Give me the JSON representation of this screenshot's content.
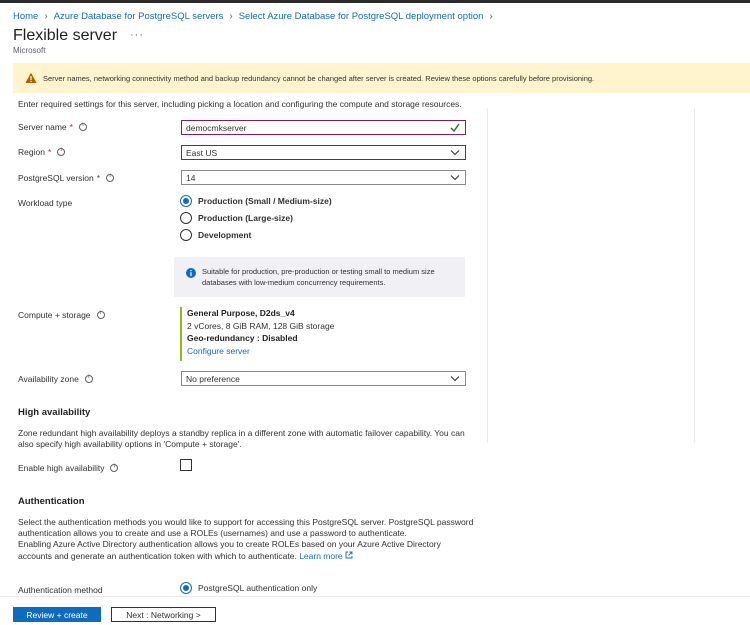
{
  "breadcrumb": [
    "Home",
    "Azure Database for PostgreSQL servers",
    "Select Azure Database for PostgreSQL deployment option"
  ],
  "header": {
    "title": "Flexible server",
    "more": "···",
    "publisher": "Microsoft"
  },
  "warning": {
    "text": "Server names, networking connectivity method and backup redundancy cannot be changed after server is created. Review these options carefully before provisioning."
  },
  "intro": "Enter required settings for this server, including picking a location and configuring the compute and storage resources.",
  "form": {
    "server_name": {
      "label": "Server name",
      "required": "*",
      "value": "democmkserver"
    },
    "region": {
      "label": "Region",
      "required": "*",
      "value": "East US"
    },
    "version": {
      "label": "PostgreSQL version",
      "required": "*",
      "value": "14"
    },
    "workload": {
      "label": "Workload type",
      "options": [
        "Production (Small / Medium-size)",
        "Production (Large-size)",
        "Development"
      ],
      "selected_index": 0,
      "info": "Suitable for production, pre-production or testing small to medium size databases with low-medium concurrency requirements."
    },
    "compute": {
      "label": "Compute + storage",
      "tier": "General Purpose, D2ds_v4",
      "specs": "2 vCores, 8 GiB RAM, 128 GiB storage",
      "geo": "Geo-redundancy : Disabled",
      "configure_link": "Configure server"
    },
    "availability_zone": {
      "label": "Availability zone",
      "value": "No preference"
    }
  },
  "high_availability": {
    "title": "High availability",
    "description_line1": "Zone redundant high availability deploys a standby replica in a different zone with automatic failover capability. You can",
    "description_line2": "also specify high availability options in 'Compute + storage'.",
    "enable_label": "Enable high availability",
    "enabled": false
  },
  "authentication": {
    "title": "Authentication",
    "line1": "Select the authentication methods you would like to support for accessing this PostgreSQL server. PostgreSQL password",
    "line2": "authentication allows you to create and use a ROLEs (usernames) and use a password to authenticate.",
    "line3": "Enabling Azure Active Directory authentication allows you to create ROLEs based on your Azure Active Directory",
    "line4": "accounts and generate an authentication token with which to authenticate.",
    "learn_more": "Learn more",
    "method_label": "Authentication method",
    "method_option": "PostgreSQL authentication only"
  },
  "footer": {
    "review_label": "Review + create",
    "next_label": "Next : Networking >"
  },
  "colors": {
    "accent": "#0f6cbd",
    "warning_bg": "#fff4ce",
    "invalid_border": "#8b1a5b",
    "success": "#107c10",
    "compute_bar": "#8cbd18"
  }
}
